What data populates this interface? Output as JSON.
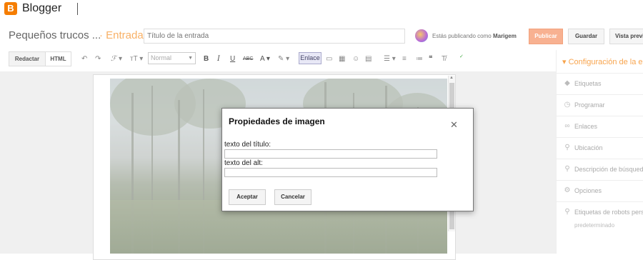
{
  "app": {
    "name": "Blogger",
    "logo_letter": "B"
  },
  "post": {
    "blog_name": "Pequeños trucos ...",
    "entry_label": "· Entrada",
    "title_placeholder": "Título de la entrada",
    "publishing_as_prefix": "Estás publicando como",
    "publishing_as_user": "Marigem"
  },
  "actions": {
    "publish": "Publicar",
    "save": "Guardar",
    "preview": "Vista previa"
  },
  "toolbar": {
    "compose": "Redactar",
    "html": "HTML",
    "font": "Normal",
    "link": "Enlace"
  },
  "sidebar": {
    "heading": "Configuración de la entrada",
    "items": [
      {
        "label": "Etiquetas",
        "icon": "tag-icon"
      },
      {
        "label": "Programar",
        "icon": "clock-icon"
      },
      {
        "label": "Enlaces",
        "icon": "link-icon"
      },
      {
        "label": "Ubicación",
        "icon": "location-pin-icon"
      },
      {
        "label": "Descripción de búsqueda",
        "icon": "search-icon"
      },
      {
        "label": "Opciones",
        "icon": "gear-icon"
      },
      {
        "label": "Etiquetas de robots personalizadas",
        "icon": "search-icon"
      }
    ],
    "robots_value": "predeterminado"
  },
  "dialog": {
    "title": "Propiedades de imagen",
    "title_field_label": "texto del título:",
    "alt_field_label": "texto del alt:",
    "title_field_value": "",
    "alt_field_value": "",
    "accept": "Aceptar",
    "cancel": "Cancelar"
  },
  "colors": {
    "accent": "#f57d00",
    "publish_button": "#f8b191"
  }
}
